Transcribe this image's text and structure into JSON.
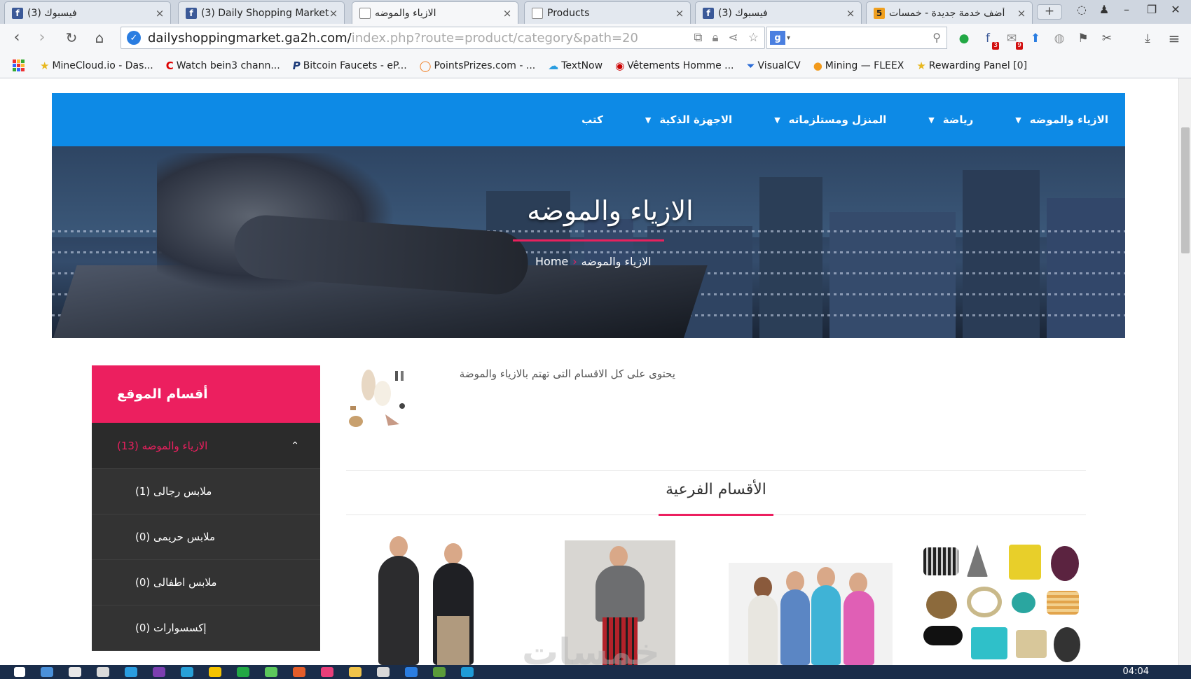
{
  "browser": {
    "tabs": [
      {
        "title": "فيسبوك (3)",
        "favicon": "facebook-icon",
        "active": false
      },
      {
        "title": "(3) Daily Shopping Market",
        "favicon": "facebook-icon",
        "active": false
      },
      {
        "title": "الازياء والموضه",
        "favicon": "document-icon",
        "active": true
      },
      {
        "title": "Products",
        "favicon": "document-icon",
        "active": false
      },
      {
        "title": "فيسبوك (3)",
        "favicon": "facebook-icon",
        "active": false
      },
      {
        "title": "أضف خدمة جديدة - خمسات",
        "favicon": "khamsat-icon",
        "active": false
      }
    ],
    "tab_close": "×",
    "new_tab": "+",
    "url_host": "dailyshoppingmarket.ga2h.com/",
    "url_path": "index.php?route=product/category&path=20",
    "search_engine_letter": "g",
    "extension_badges": {
      "facebook": "3",
      "gmail": "9"
    },
    "bookmarks": [
      {
        "label": "MineCloud.io - Das...",
        "icon": "star-icon"
      },
      {
        "label": "Watch bein3 chann...",
        "icon": "c-logo-icon"
      },
      {
        "label": "Bitcoin Faucets - eP...",
        "icon": "p-logo-icon"
      },
      {
        "label": "PointsPrizes.com - ...",
        "icon": "ring-logo-icon"
      },
      {
        "label": "TextNow",
        "icon": "cloud-icon"
      },
      {
        "label": "Vêtements Homme ...",
        "icon": "red-logo-icon"
      },
      {
        "label": "VisualCV",
        "icon": "funnel-icon"
      },
      {
        "label": "Mining — FLEEX",
        "icon": "bitcoin-icon"
      },
      {
        "label": "Rewarding Panel [0]",
        "icon": "star-icon"
      }
    ]
  },
  "site": {
    "nav": [
      {
        "label": "الازياء والموضه",
        "has_dropdown": true
      },
      {
        "label": "رياضة",
        "has_dropdown": true
      },
      {
        "label": "المنزل ومستلزماته",
        "has_dropdown": true
      },
      {
        "label": "الاجهزة الذكية",
        "has_dropdown": true
      },
      {
        "label": "كتب",
        "has_dropdown": false
      }
    ],
    "hero": {
      "title": "الازياء والموضه",
      "breadcrumb_home": "Home",
      "breadcrumb_sep": "›",
      "breadcrumb_current": "الازياء والموضه"
    },
    "sidebar": {
      "heading": "أقسام الموقع",
      "parent": "الازياء والموضه (13)",
      "children": [
        "ملابس رجالى (1)",
        "ملابس حريمى (0)",
        "ملابس اطفالى (0)",
        "إكسسوارات (0)"
      ]
    },
    "category_description": "يحتوى على كل الاقسام التى تهتم بالازياء والموضة",
    "subcategories_heading": "الأقسام الفرعية",
    "watermark": "خمسات"
  },
  "taskbar": {
    "clock": "04:04"
  },
  "colors": {
    "nav_blue": "#0d8ae6",
    "accent_pink": "#ec1f5f",
    "sidebar_dark": "#333333"
  }
}
